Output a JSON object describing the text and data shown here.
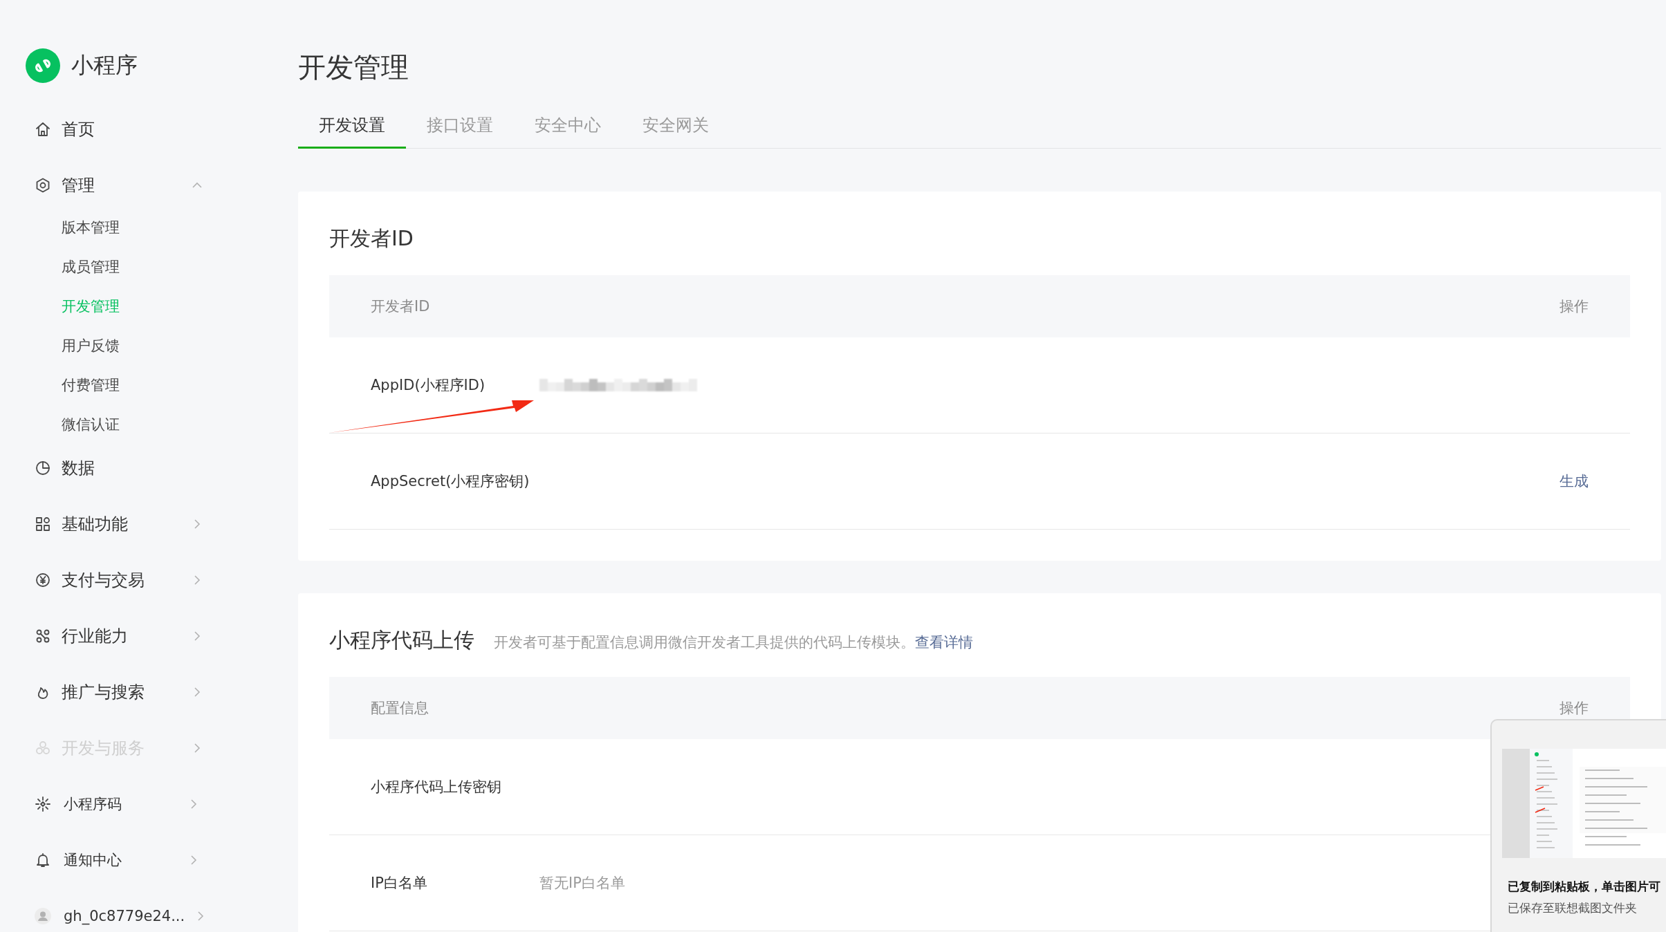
{
  "app": {
    "name": "小程序"
  },
  "sidebar": {
    "items": [
      {
        "label": "首页",
        "kind": "nav",
        "disabled": false
      },
      {
        "label": "管理",
        "kind": "nav",
        "disabled": false,
        "expanded": true,
        "children": [
          {
            "label": "版本管理",
            "selected": false
          },
          {
            "label": "成员管理",
            "selected": false
          },
          {
            "label": "开发管理",
            "selected": true
          },
          {
            "label": "用户反馈",
            "selected": false
          },
          {
            "label": "付费管理",
            "selected": false
          },
          {
            "label": "微信认证",
            "selected": false
          }
        ]
      },
      {
        "label": "数据",
        "kind": "nav",
        "disabled": false
      },
      {
        "label": "基础功能",
        "kind": "nav",
        "disabled": false,
        "expanded": false
      },
      {
        "label": "支付与交易",
        "kind": "nav",
        "disabled": false,
        "expanded": false
      },
      {
        "label": "行业能力",
        "kind": "nav",
        "disabled": false,
        "expanded": false
      },
      {
        "label": "推广与搜索",
        "kind": "nav",
        "disabled": false,
        "expanded": false
      },
      {
        "label": "开发与服务",
        "kind": "nav",
        "disabled": true,
        "expanded": false
      },
      {
        "label": "小程序码",
        "kind": "utility",
        "disabled": false,
        "expanded": false
      },
      {
        "label": "通知中心",
        "kind": "utility",
        "disabled": false,
        "expanded": false
      },
      {
        "label": "gh_0c8779e24...",
        "kind": "account",
        "disabled": false,
        "expanded": false
      }
    ]
  },
  "page": {
    "title": "开发管理"
  },
  "tabs": [
    {
      "label": "开发设置",
      "selected": true
    },
    {
      "label": "接口设置",
      "selected": false
    },
    {
      "label": "安全中心",
      "selected": false
    },
    {
      "label": "安全网关",
      "selected": false
    }
  ],
  "sections": [
    {
      "title": "开发者ID",
      "columns": [
        "开发者ID",
        "操作"
      ],
      "rows": [
        {
          "label": "AppID(小程序ID)",
          "kind": "redacted"
        },
        {
          "label": "AppSecret(小程序密钥)",
          "kind": "plain",
          "action": "生成"
        }
      ]
    },
    {
      "title": "小程序代码上传",
      "description": "开发者可基于配置信息调用微信开发者工具提供的代码上传模块。",
      "link": "查看详情",
      "columns": [
        "配置信息",
        "操作"
      ],
      "rows": [
        {
          "label": "小程序代码上传密钥",
          "kind": "plain"
        },
        {
          "label": "IP白名单",
          "kind": "plain",
          "value": "暂无IP白名单"
        }
      ]
    }
  ],
  "toast": {
    "title": "已复制到粘贴板，单击图片可",
    "message": "已保存至联想截图文件夹"
  }
}
